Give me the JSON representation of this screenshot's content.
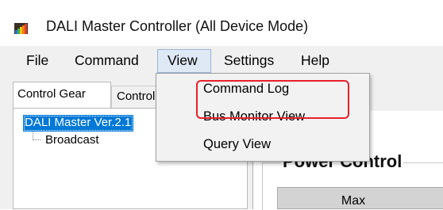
{
  "window": {
    "title": "DALI Master Controller (All Device Mode)",
    "icon": "dali-app-icon"
  },
  "menubar": {
    "items": [
      "File",
      "Command",
      "View",
      "Settings",
      "Help"
    ],
    "open_menu": "View"
  },
  "view_menu": {
    "items": [
      "Command Log",
      "Bus Monitor View",
      "Query View"
    ]
  },
  "tabs": {
    "items": [
      "Control Gear",
      "Control Device"
    ],
    "selected": "Control Gear"
  },
  "tree": {
    "root": "DALI Master Ver.2.1",
    "children": [
      "Broadcast"
    ]
  },
  "power_control": {
    "title": "Power Control",
    "max_button": "Max"
  },
  "annotation": {
    "color": "#e8202a"
  }
}
